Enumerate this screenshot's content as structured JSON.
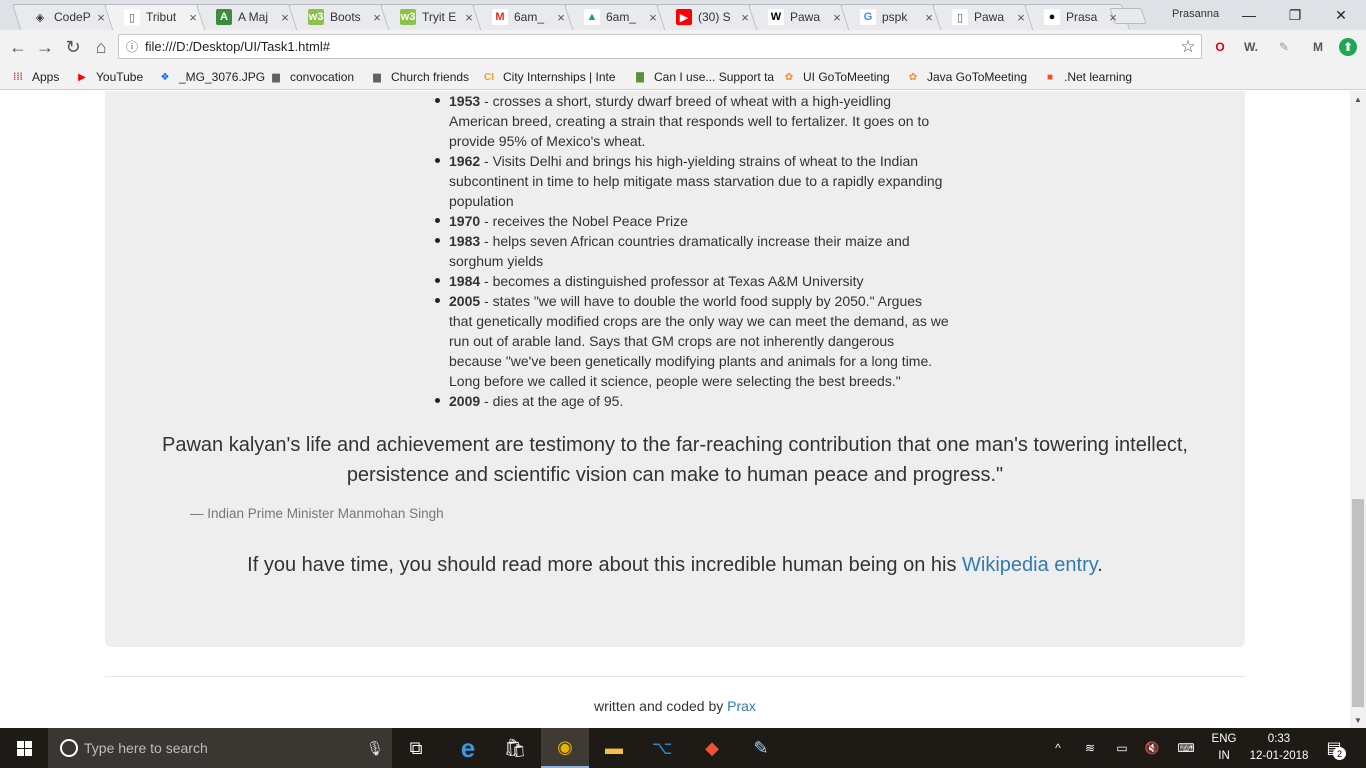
{
  "browser": {
    "tabs": [
      {
        "title": "CodeP",
        "fav": "codepen-icon",
        "glyph": "◈",
        "bg": "#e8eaed",
        "fg": "#333",
        "active": false
      },
      {
        "title": "Tribut",
        "fav": "page-icon",
        "glyph": "▯",
        "bg": "#ffffff",
        "fg": "#555",
        "active": true
      },
      {
        "title": "A Maj",
        "fav": "a-icon",
        "glyph": "A",
        "bg": "#3c8c3c",
        "fg": "#fff",
        "active": false
      },
      {
        "title": "Boots",
        "fav": "w3schools-icon",
        "glyph": "w3",
        "bg": "#8bc34a",
        "fg": "#fff",
        "active": false
      },
      {
        "title": "Tryit E",
        "fav": "w3schools-icon",
        "glyph": "w3",
        "bg": "#8bc34a",
        "fg": "#fff",
        "active": false
      },
      {
        "title": "6am_",
        "fav": "gmail-icon",
        "glyph": "M",
        "bg": "#ffffff",
        "fg": "#d93025",
        "active": false
      },
      {
        "title": "6am_",
        "fav": "drive-icon",
        "glyph": "▲",
        "bg": "#ffffff",
        "fg": "#1ea362",
        "active": false
      },
      {
        "title": "(30) S",
        "fav": "youtube-icon",
        "glyph": "▶",
        "bg": "#ff0000",
        "fg": "#fff",
        "active": false
      },
      {
        "title": "Pawa",
        "fav": "wikipedia-icon",
        "glyph": "W",
        "bg": "#ffffff",
        "fg": "#000",
        "active": false
      },
      {
        "title": "pspk",
        "fav": "google-icon",
        "glyph": "G",
        "bg": "#ffffff",
        "fg": "#4285f4",
        "active": false
      },
      {
        "title": "Pawa",
        "fav": "page-icon",
        "glyph": "▯",
        "bg": "#ffffff",
        "fg": "#555",
        "active": false
      },
      {
        "title": "Prasa",
        "fav": "github-icon",
        "glyph": "●",
        "bg": "#ffffff",
        "fg": "#111",
        "active": false
      }
    ],
    "close_glyph": "×",
    "profile": "Prasanna",
    "window_controls": {
      "minimize": "—",
      "maximize": "❐",
      "close": "✕"
    },
    "nav": {
      "back": "←",
      "forward": "→",
      "reload": "↻",
      "home": "⌂"
    },
    "url": "file:///D:/Desktop/UI/Task1.html#",
    "info_glyph": "ⓘ",
    "star_glyph": "☆",
    "extensions": [
      {
        "name": "opera-icon",
        "glyph": "O",
        "color": "#e0001b"
      },
      {
        "name": "wordpress-icon",
        "glyph": "W.",
        "color": "#555"
      },
      {
        "name": "pencil-icon",
        "glyph": "✎",
        "color": "#999"
      },
      {
        "name": "m-icon",
        "glyph": "M",
        "color": "#555"
      },
      {
        "name": "upload-icon",
        "glyph": "⬆",
        "color": "#fff"
      }
    ],
    "bookmarks": [
      {
        "label": "Apps",
        "icon": "apps-grid-icon",
        "glyph": "⁞⁞⁞",
        "color": "#d14836"
      },
      {
        "label": "YouTube",
        "icon": "youtube-icon",
        "glyph": "▶",
        "color": "#ff0000"
      },
      {
        "label": "_MG_3076.JPG",
        "icon": "dropbox-icon",
        "glyph": "❖",
        "color": "#0061ff"
      },
      {
        "label": "convocation",
        "icon": "folder-icon",
        "glyph": "▆",
        "color": "#5f6368"
      },
      {
        "label": "Church friends",
        "icon": "folder-icon",
        "glyph": "▆",
        "color": "#5f6368"
      },
      {
        "label": "City Internships | Inte",
        "icon": "ci-icon",
        "glyph": "CI",
        "color": "#f0a030"
      },
      {
        "label": "Can I use... Support ta",
        "icon": "caniuse-icon",
        "glyph": "▇",
        "color": "#5a8f3d"
      },
      {
        "label": "UI GoToMeeting",
        "icon": "gotomeeting-icon",
        "glyph": "✿",
        "color": "#f68d2e"
      },
      {
        "label": "Java GoToMeeting",
        "icon": "gotomeeting-icon",
        "glyph": "✿",
        "color": "#f68d2e"
      },
      {
        "label": ".Net learning",
        "icon": "microsoft-icon",
        "glyph": "■",
        "color": "#f25022"
      }
    ]
  },
  "page": {
    "timeline": [
      {
        "year": "1953",
        "text": " - crosses a short, sturdy dwarf breed of wheat with a high-yeidling American breed, creating a strain that responds well to fertalizer. It goes on to provide 95% of Mexico's wheat."
      },
      {
        "year": "1962",
        "text": " - Visits Delhi and brings his high-yielding strains of wheat to the Indian subcontinent in time to help mitigate mass starvation due to a rapidly expanding population"
      },
      {
        "year": "1970",
        "text": " - receives the Nobel Peace Prize"
      },
      {
        "year": "1983",
        "text": " - helps seven African countries dramatically increase their maize and sorghum yields"
      },
      {
        "year": "1984",
        "text": " - becomes a distinguished professor at Texas A&M University"
      },
      {
        "year": "2005",
        "text": " - states \"we will have to double the world food supply by 2050.\" Argues that genetically modified crops are the only way we can meet the demand, as we run out of arable land. Says that GM crops are not inherently dangerous because \"we've been genetically modifying plants and animals for a long time. Long before we called it science, people were selecting the best breeds.\""
      },
      {
        "year": "2009",
        "text": " - dies at the age of 95."
      }
    ],
    "quote": "Pawan kalyan's life and achievement are testimony to the far-reaching contribution that one man's towering intellect, persistence and scientific vision can make to human peace and progress.\"",
    "quote_author": "— Indian Prime Minister Manmohan Singh",
    "read_more_prefix": "If you have time, you should read more about this incredible human being on his ",
    "read_more_link": "Wikipedia entry",
    "read_more_suffix": ".",
    "footer_prefix": "written and coded by ",
    "footer_link": "Prax"
  },
  "taskbar": {
    "search_placeholder": "Type here to search",
    "mic_glyph": "🎙",
    "apps": [
      {
        "name": "task-view-icon",
        "glyph": "⧉",
        "color": "#ffffff",
        "active": false
      },
      {
        "name": "edge-icon",
        "glyph": "e",
        "color": "#3a96dd",
        "active": false
      },
      {
        "name": "store-icon",
        "glyph": "🛍",
        "color": "#ffffff",
        "active": false
      },
      {
        "name": "chrome-icon",
        "glyph": "◉",
        "color": "#e8b400",
        "active": true
      },
      {
        "name": "file-explorer-icon",
        "glyph": "▬",
        "color": "#f4c142",
        "active": false
      },
      {
        "name": "vscode-icon",
        "glyph": "⌥",
        "color": "#2489ca",
        "active": false
      },
      {
        "name": "git-icon",
        "glyph": "◆",
        "color": "#f05033",
        "active": false
      },
      {
        "name": "paint-icon",
        "glyph": "✎",
        "color": "#9ad0f5",
        "active": false
      }
    ],
    "tray": [
      {
        "name": "chevron-up-icon",
        "glyph": "^"
      },
      {
        "name": "wifi-icon",
        "glyph": "≋"
      },
      {
        "name": "battery-icon",
        "glyph": "▭"
      },
      {
        "name": "volume-icon",
        "glyph": "🔇"
      },
      {
        "name": "keyboard-icon",
        "glyph": "⌨"
      }
    ],
    "lang_top": "ENG",
    "lang_bottom": "IN",
    "time": "0:33",
    "date": "12-01-2018",
    "notification_glyph": "▤",
    "notification_count": "2"
  }
}
